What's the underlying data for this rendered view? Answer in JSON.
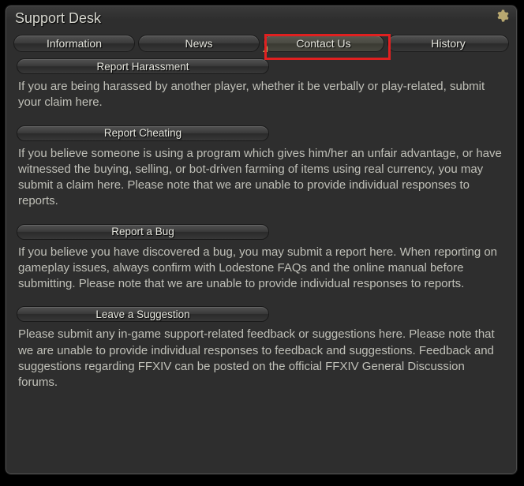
{
  "window": {
    "title": "Support Desk"
  },
  "tabs": [
    {
      "label": "Information",
      "active": false
    },
    {
      "label": "News",
      "active": false
    },
    {
      "label": "Contact Us",
      "active": true
    },
    {
      "label": "History",
      "active": false
    }
  ],
  "sections": [
    {
      "header": "Report Harassment",
      "body": "If you are being harassed by another player, whether it be verbally or play-related, submit your claim here."
    },
    {
      "header": "Report Cheating",
      "body": "If you believe someone is using a program which gives him/her an unfair advantage, or have witnessed the buying, selling, or bot-driven farming of items using real currency, you may submit a claim here. Please note that we are unable to provide individual responses to reports."
    },
    {
      "header": "Report a Bug",
      "body": "If you believe you have discovered a bug, you may submit a report here. When reporting on gameplay issues, always confirm with Lodestone FAQs and the online manual before submitting. Please note that we are unable to provide individual responses to reports."
    },
    {
      "header": "Leave a Suggestion",
      "body": "Please submit any in-game support-related feedback or suggestions here. Please note that we are unable to provide individual responses to feedback and suggestions. Feedback and suggestions regarding FFXIV can be posted on the official FFXIV General Discussion forums."
    }
  ]
}
